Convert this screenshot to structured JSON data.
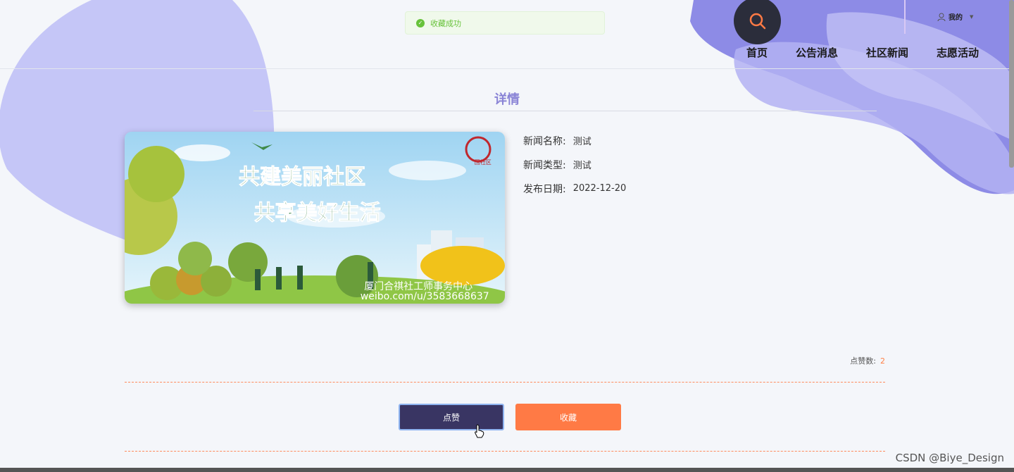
{
  "toast": {
    "message": "收藏成功",
    "icon": "check-circle-icon"
  },
  "header": {
    "search_icon": "search-icon",
    "user_label": "我的",
    "nav": [
      {
        "label": "首页"
      },
      {
        "label": "公告消息"
      },
      {
        "label": "社区新闻"
      },
      {
        "label": "志愿活动"
      }
    ]
  },
  "page": {
    "title": "详情"
  },
  "poster": {
    "line1": "共建美丽社区",
    "line2": "共享美好生活",
    "source": "厦门合祺社工师事务中心",
    "url": "weibo.com/u/3583668637",
    "logo_text": "国社区"
  },
  "details": [
    {
      "label": "新闻名称:",
      "value": "测试"
    },
    {
      "label": "新闻类型:",
      "value": "测试"
    },
    {
      "label": "发布日期:",
      "value": "2022-12-20"
    }
  ],
  "likes": {
    "label": "点赞数:",
    "count": "2"
  },
  "buttons": {
    "like": "点赞",
    "favorite": "收藏"
  },
  "watermark": "CSDN @Biye_Design",
  "colors": {
    "accent": "#8a84d6",
    "primary_button": "#393563",
    "favorite_button": "#ff7a45",
    "toast_green": "#67c23a"
  }
}
